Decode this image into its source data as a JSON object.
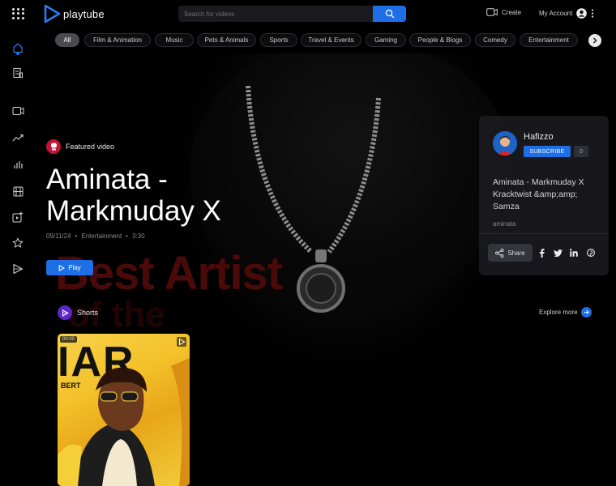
{
  "app": {
    "name": "playtube"
  },
  "header": {
    "search_placeholder": "Search for videos",
    "create_label": "Create",
    "account_label": "My Account"
  },
  "categories": [
    "All",
    "Film & Animation",
    "Music",
    "Pets & Animals",
    "Sports",
    "Travel & Events",
    "Gaming",
    "People & Blogs",
    "Comedy",
    "Entertainment"
  ],
  "featured": {
    "badge": "Featured video",
    "title": "Aminata - Markmuday X",
    "date": "09/11/24",
    "category": "Entertainment",
    "duration": "3:30",
    "play_label": "Play",
    "background_text_line1": "Best Artist",
    "background_text_line2": "of the"
  },
  "channel_card": {
    "name": "Hafizzo",
    "subscribe_label": "SUBSCRIBE",
    "subscriber_count": "0",
    "video_title": "Aminata - Markmuday X Kracktwist &amp;amp; Samza",
    "owner": "aminata",
    "share_label": "Share"
  },
  "shorts": {
    "label": "Shorts",
    "explore_label": "Explore more",
    "items": [
      {
        "duration": "00:00",
        "thumb_text": "IAR",
        "thumb_sub": "BERT"
      }
    ]
  },
  "colors": {
    "accent": "#1e6fe6",
    "featured_badge": "#c2143a",
    "shorts_badge": "#5a26c9"
  }
}
